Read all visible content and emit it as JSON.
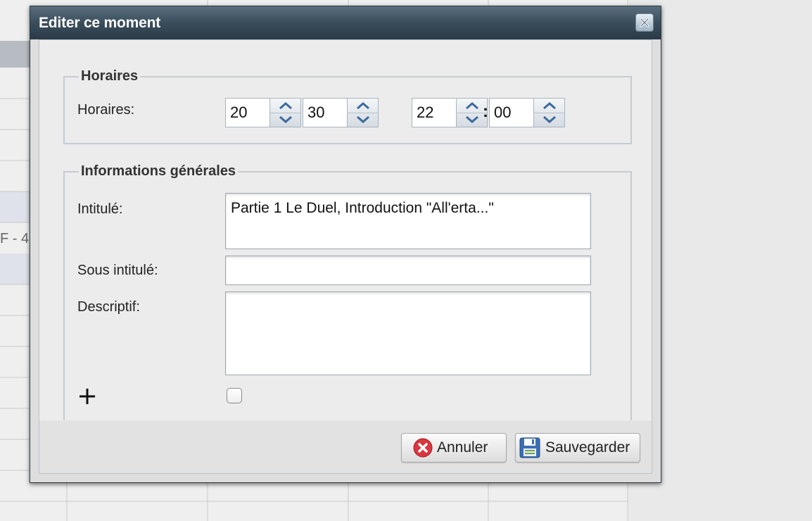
{
  "background": {
    "left_label": "F - 4"
  },
  "dialog": {
    "title": "Editer ce moment",
    "close_icon": "close-icon",
    "horaires": {
      "legend": "Horaires",
      "label": "Horaires:",
      "start_hour": "20",
      "start_minute": "30",
      "end_hour": "22",
      "end_minute": "00",
      "separator": ":"
    },
    "infos": {
      "legend": "Informations générales",
      "intitule_label": "Intitulé:",
      "intitule_value": "Partie 1 Le Duel, Introduction \"All'erta...\"",
      "sous_intitule_label": "Sous intitulé:",
      "sous_intitule_value": "",
      "descriptif_label": "Descriptif:",
      "descriptif_value": "",
      "plus_label": "+",
      "checkbox_checked": false
    },
    "buttons": {
      "cancel_label": "Annuler",
      "save_label": "Sauvegarder"
    },
    "colors": {
      "titlebar": "#3a4d5b",
      "cancel_icon": "#d9363e",
      "save_icon": "#3a6fb5"
    }
  }
}
